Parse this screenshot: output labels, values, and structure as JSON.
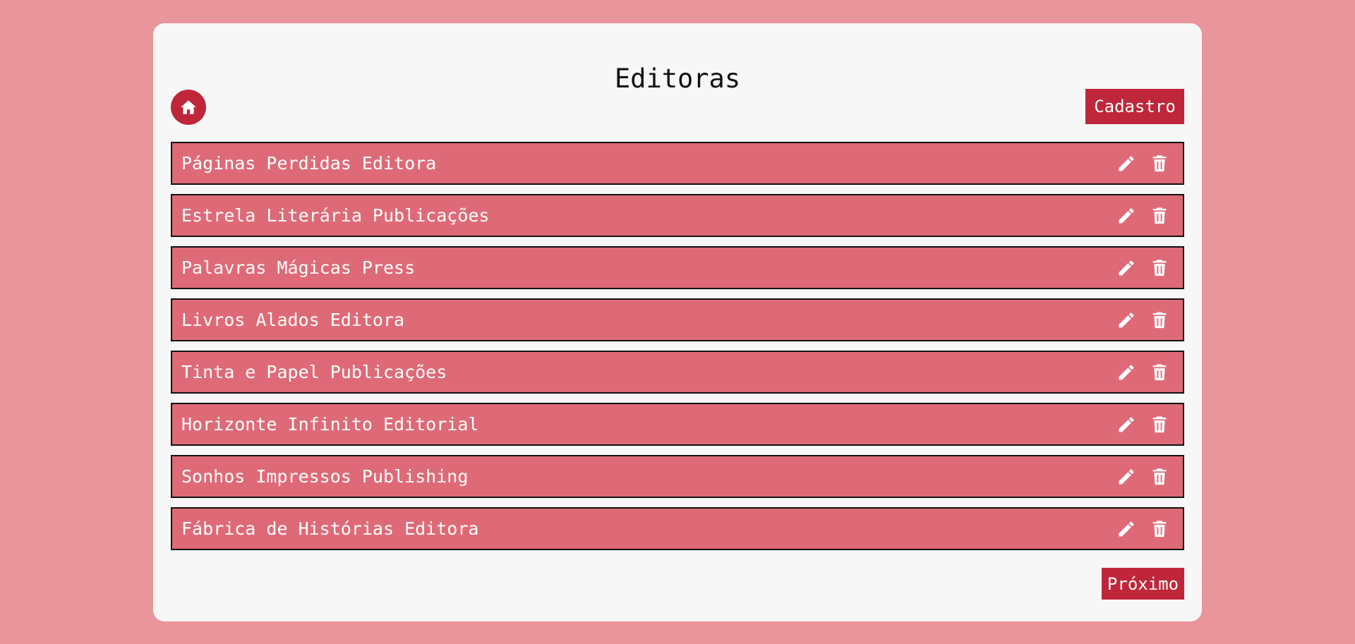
{
  "page": {
    "title": "Editoras"
  },
  "toolbar": {
    "home_icon": "home-icon",
    "cadastro_label": "Cadastro"
  },
  "publishers": [
    {
      "name": "Páginas Perdidas Editora"
    },
    {
      "name": "Estrela Literária Publicações"
    },
    {
      "name": "Palavras Mágicas Press"
    },
    {
      "name": "Livros Alados Editora"
    },
    {
      "name": "Tinta e Papel Publicações"
    },
    {
      "name": "Horizonte Infinito Editorial"
    },
    {
      "name": "Sonhos Impressos Publishing"
    },
    {
      "name": "Fábrica de Histórias Editora"
    }
  ],
  "row_actions": {
    "edit_icon": "pencil-icon",
    "delete_icon": "trash-icon"
  },
  "pagination": {
    "next_label": "Próximo"
  },
  "colors": {
    "background": "#e9959b",
    "card": "#f7f7f7",
    "accent": "#c0263a",
    "row": "#df6a77"
  }
}
